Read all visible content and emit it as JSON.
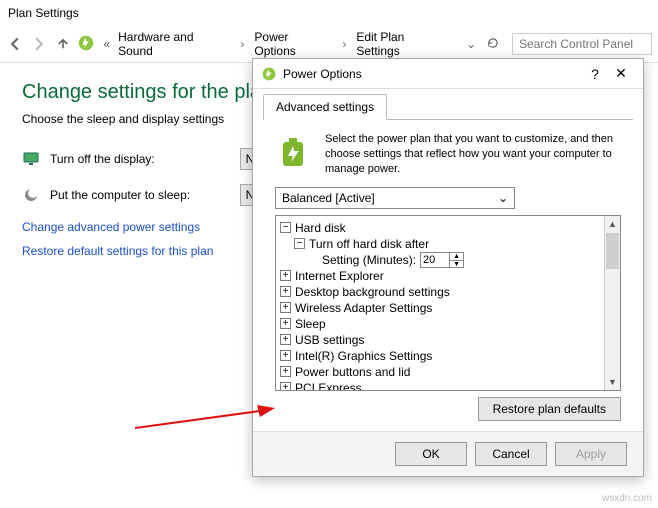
{
  "window": {
    "title": "Plan Settings"
  },
  "breadcrumb": {
    "a": "Hardware and Sound",
    "b": "Power Options",
    "c": "Edit Plan Settings"
  },
  "search": {
    "placeholder": "Search Control Panel"
  },
  "page": {
    "heading": "Change settings for the plan",
    "subtitle": "Choose the sleep and display settings",
    "row1_label": "Turn off the display:",
    "row1_value": "N",
    "row2_label": "Put the computer to sleep:",
    "row2_value": "N",
    "link_advanced": "Change advanced power settings",
    "link_restore": "Restore default settings for this plan"
  },
  "dialog": {
    "title": "Power Options",
    "tab": "Advanced settings",
    "info_text": "Select the power plan that you want to customize, and then choose settings that reflect how you want your computer to manage power.",
    "plan_value": "Balanced [Active]",
    "tree": {
      "hard_disk": "Hard disk",
      "turn_off_after": "Turn off hard disk after",
      "setting_label": "Setting (Minutes):",
      "setting_value": "20",
      "ie": "Internet Explorer",
      "desktop_bg": "Desktop background settings",
      "wireless": "Wireless Adapter Settings",
      "sleep": "Sleep",
      "usb": "USB settings",
      "intel": "Intel(R) Graphics Settings",
      "power_buttons": "Power buttons and lid",
      "pci": "PCI Express"
    },
    "restore": "Restore plan defaults",
    "ok": "OK",
    "cancel": "Cancel",
    "apply": "Apply"
  },
  "watermark": "wsxdn.com"
}
